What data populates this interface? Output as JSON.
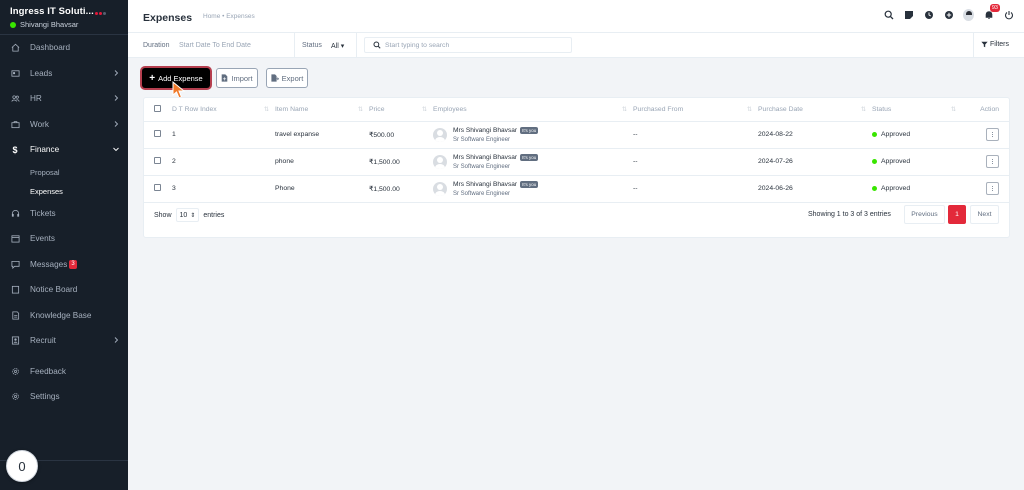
{
  "brand": {
    "company": "Ingress IT Soluti...",
    "user": "Shivangi Bhavsar"
  },
  "sidebar": {
    "items": [
      {
        "label": "Dashboard",
        "icon": "house-icon"
      },
      {
        "label": "Leads",
        "icon": "id-card-icon"
      },
      {
        "label": "HR",
        "icon": "people-icon"
      },
      {
        "label": "Work",
        "icon": "briefcase-icon"
      },
      {
        "label": "Finance",
        "icon": "dollar-icon"
      },
      {
        "label": "Tickets",
        "icon": "headset-icon"
      },
      {
        "label": "Events",
        "icon": "calendar-icon"
      },
      {
        "label": "Messages",
        "icon": "chat-icon",
        "badge": "3"
      },
      {
        "label": "Notice Board",
        "icon": "clipboard-icon"
      },
      {
        "label": "Knowledge Base",
        "icon": "book-icon"
      },
      {
        "label": "Recruit",
        "icon": "user-badge-icon"
      },
      {
        "label": "Feedback",
        "icon": "gear-icon"
      },
      {
        "label": "Settings",
        "icon": "gear-icon"
      }
    ],
    "finance_sub": [
      "Proposal",
      "Expenses"
    ]
  },
  "floating_counter": "0",
  "header": {
    "title": "Expenses",
    "breadcrumb": "Home • Expenses",
    "notification_count": "93"
  },
  "filters": {
    "duration_label": "Duration",
    "duration_value": "Start Date To End Date",
    "status_label": "Status",
    "status_value": "All",
    "search_placeholder": "Start typing to search",
    "filters_label": "Filters"
  },
  "actions": {
    "add": "Add Expense",
    "import": "Import",
    "export": "Export"
  },
  "table": {
    "columns": [
      "D T Row Index",
      "Item Name",
      "Price",
      "Employees",
      "Purchased From",
      "Purchase Date",
      "Status",
      "Action"
    ],
    "rows": [
      {
        "index": "1",
        "item": "travel expanse",
        "price": "₹500.00",
        "employee": "Mrs Shivangi Bhavsar",
        "tag": "It's you",
        "role": "Sr Software Engineer",
        "from": "--",
        "date": "2024-08-22",
        "status": "Approved"
      },
      {
        "index": "2",
        "item": "phone",
        "price": "₹1,500.00",
        "employee": "Mrs Shivangi Bhavsar",
        "tag": "It's you",
        "role": "Sr Software Engineer",
        "from": "--",
        "date": "2024-07-26",
        "status": "Approved"
      },
      {
        "index": "3",
        "item": "Phone",
        "price": "₹1,500.00",
        "employee": "Mrs Shivangi Bhavsar",
        "tag": "It's you",
        "role": "Sr Software Engineer",
        "from": "--",
        "date": "2024-06-26",
        "status": "Approved"
      }
    ]
  },
  "pagination": {
    "show_label": "Show",
    "page_size": "10",
    "entries_label": "entries",
    "summary": "Showing 1 to 3 of 3 entries",
    "previous": "Previous",
    "current": "1",
    "next": "Next"
  },
  "colors": {
    "sidebar": "#171f29",
    "accent": "#e3293a",
    "approved": "#39e500"
  }
}
